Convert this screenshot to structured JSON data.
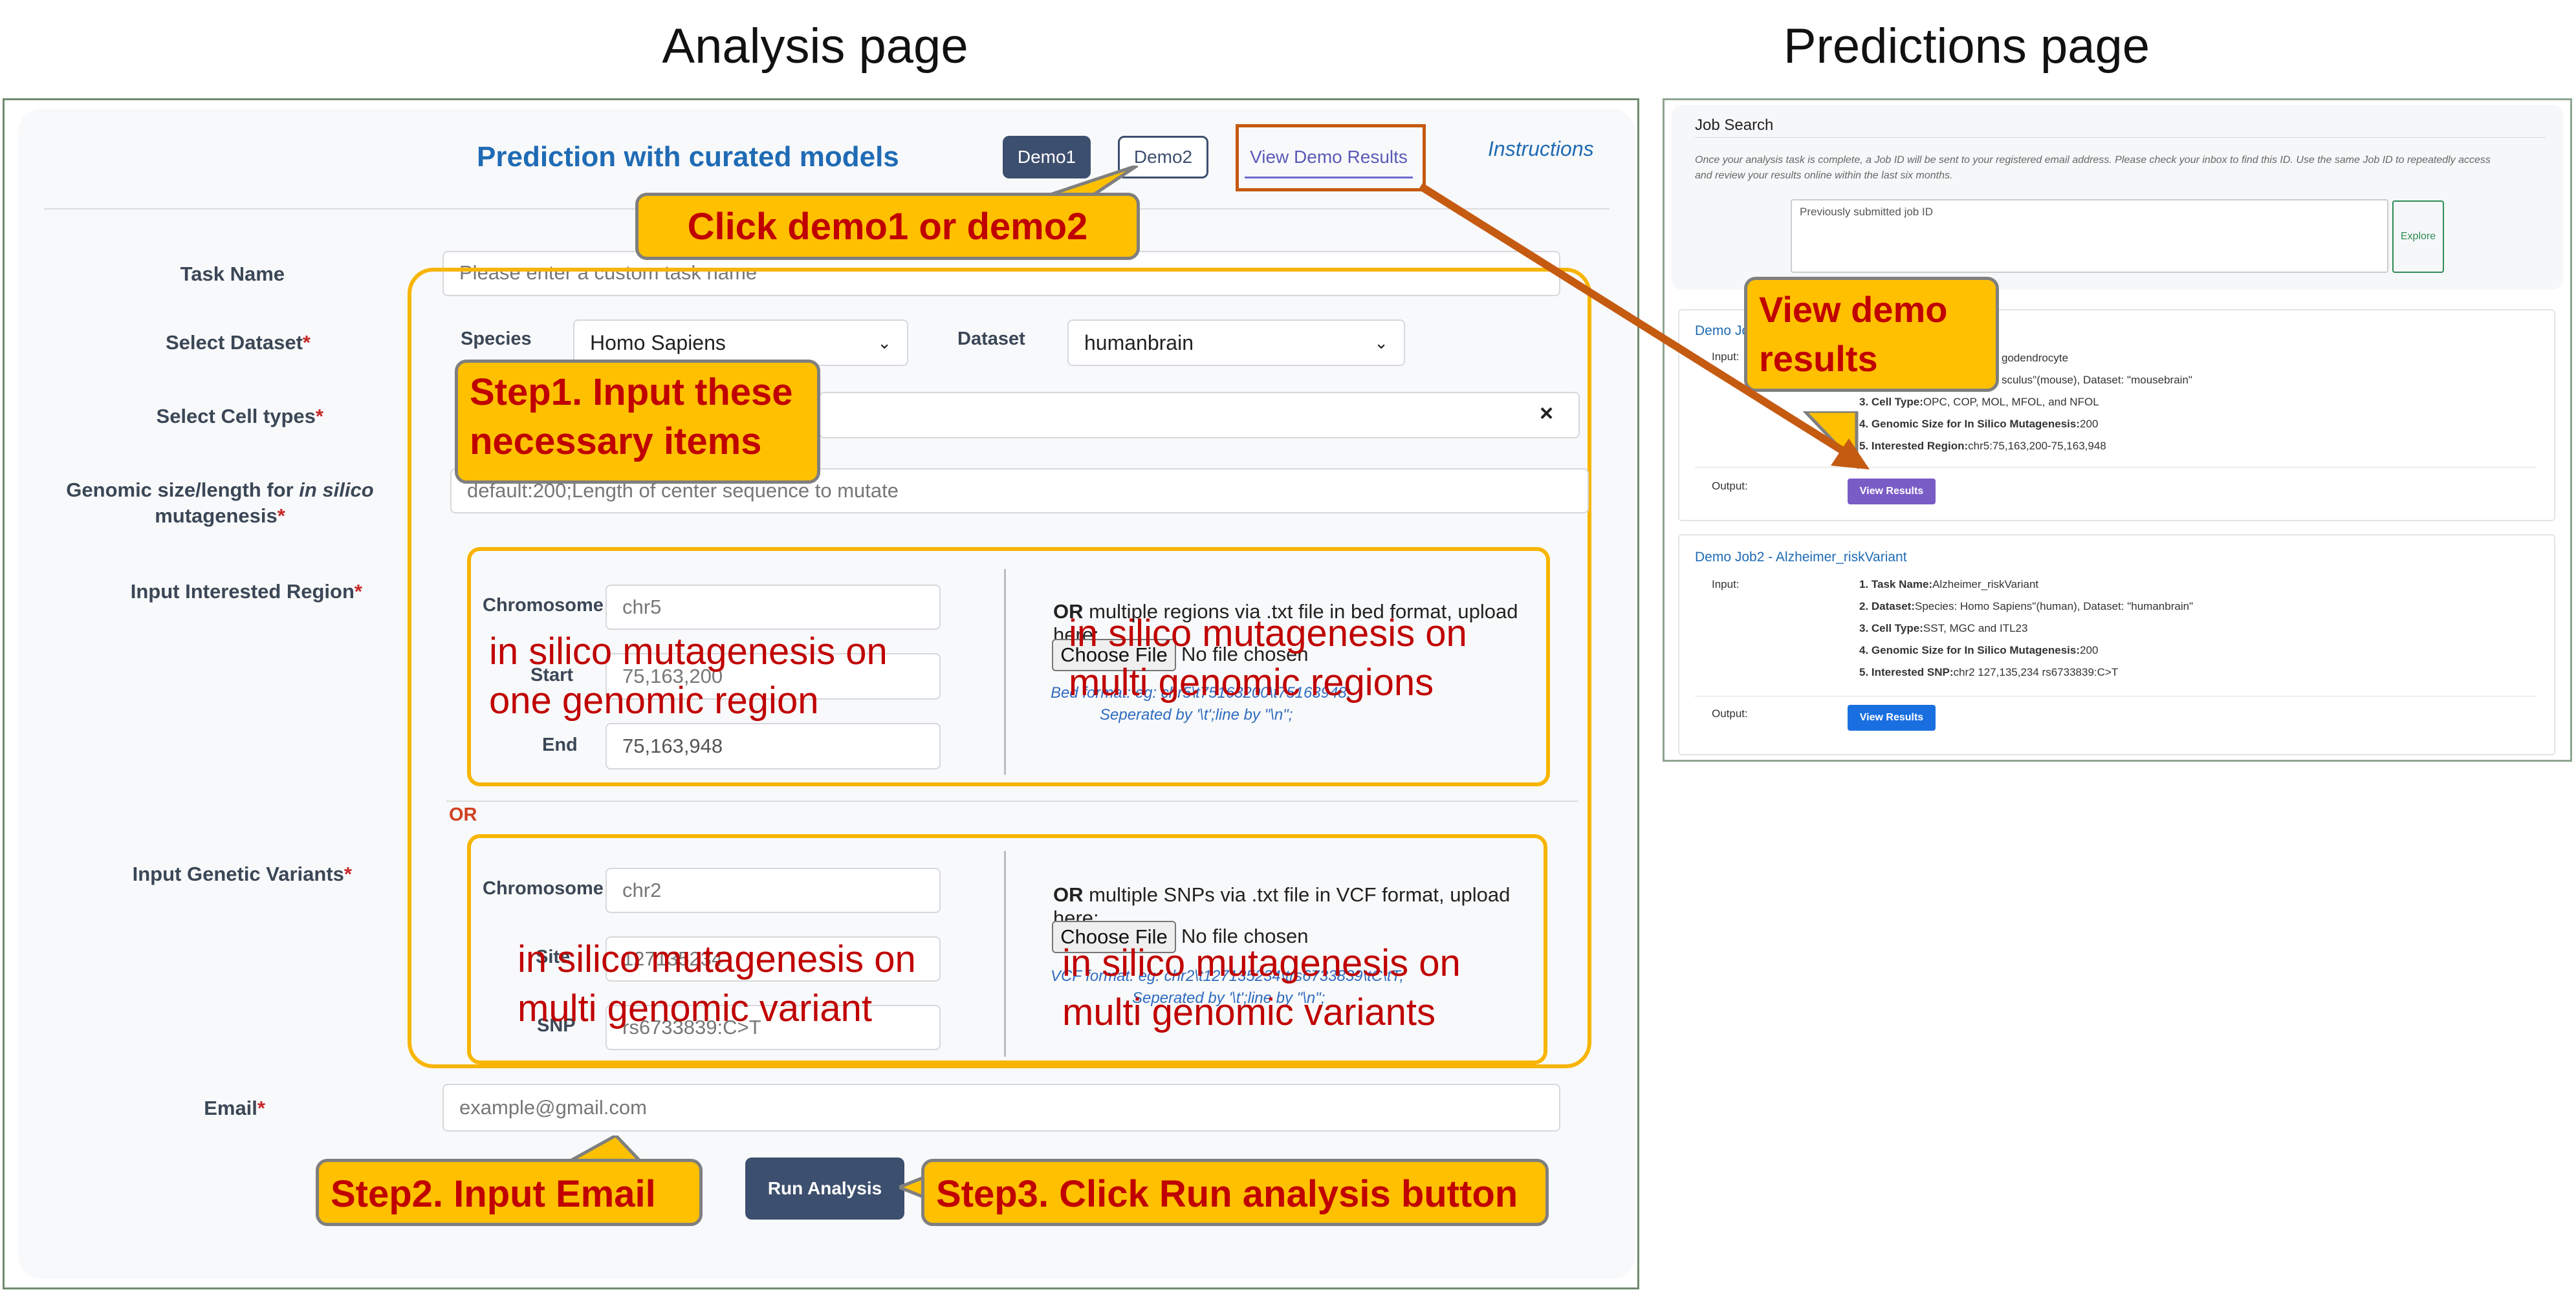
{
  "headings": {
    "analysis": "Analysis page",
    "predictions": "Predictions page"
  },
  "analysis": {
    "title": "Prediction with curated models",
    "demo1": "Demo1",
    "demo2": "Demo2",
    "view_demo": "View Demo Results",
    "instructions": "Instructions",
    "task_name": {
      "label": "Task Name",
      "placeholder": "Please enter a custom task name"
    },
    "dataset": {
      "label": "Select Dataset",
      "species_label": "Species",
      "species_value": "Homo Sapiens",
      "dataset_label": "Dataset",
      "dataset_value": "humanbrain"
    },
    "cell_types": {
      "label": "Select Cell types",
      "clear": "×"
    },
    "genomic_size": {
      "label_pre": "Genomic size/length for ",
      "label_em": "in silico",
      "label_post": " mutagenesis",
      "placeholder": "default:200;Length of center sequence to mutate"
    },
    "region": {
      "label": "Input Interested Region",
      "chromosome_label": "Chromosome",
      "chromosome_value": "chr5",
      "start_label": "Start",
      "start_value": "75,163,200",
      "end_label": "End",
      "end_value": "75,163,948",
      "or_label": "OR",
      "upload_text": " multiple regions via .txt file in bed format, upload here:",
      "choose_file": "Choose File",
      "no_file": "No file chosen",
      "hint1": "Bed format: eg: chr5\\t75163200\\t75163948;",
      "hint2": "Seperated by '\\t';line by \"\\n\";"
    },
    "or_between": "OR",
    "variants": {
      "label": "Input Genetic Variants",
      "chromosome_label": "Chromosome",
      "chromosome_value": "chr2",
      "site_label": "Site",
      "site_value": "127135234",
      "snp_label": "SNP",
      "snp_value": "rs6733839:C>T",
      "or_label": "OR",
      "upload_text": " multiple SNPs via .txt file in VCF format, upload here:",
      "choose_file": "Choose File",
      "no_file": "No file chosen",
      "hint1": "VCF format: eg: chr2\\t127135234\\trs6733839\\tC\\tT;",
      "hint2": "Seperated by '\\t';line by \"\\n\";"
    },
    "email": {
      "label": "Email",
      "placeholder": "example@gmail.com"
    },
    "run": "Run Analysis",
    "req_mark": "*"
  },
  "annotations": {
    "click_demo": "Click demo1 or demo2",
    "step1_line1": "Step1. Input these",
    "step1_line2": "necessary items",
    "region_single_1": "in silico mutagenesis on",
    "region_single_2": "one genomic region",
    "region_multi_1": "in silico mutagenesis on",
    "region_multi_2": "multi genomic regions",
    "variant_single_1": "in silico mutagenesis on",
    "variant_single_2": "multi genomic variant",
    "variant_multi_1": "in silico mutagenesis on",
    "variant_multi_2": "multi genomic variants",
    "step2": "Step2. Input Email",
    "step3": "Step3. Click Run analysis button",
    "view_demo_1": "View demo",
    "view_demo_2": "results"
  },
  "predictions": {
    "job_search_title": "Job Search",
    "job_search_desc_1": "Once your analysis task is complete, a Job ID will be sent to your registered email address. Please check your inbox to find this ID. Use the same Job ID to repeatedly access",
    "job_search_desc_2": "and review your results online within the last six months.",
    "job_id_placeholder": "Previously submitted job ID",
    "explore": "Explore",
    "job1": {
      "title": "Demo Job1",
      "input_label": "Input:",
      "items": [
        {
          "k": "",
          "v": "godendrocyte"
        },
        {
          "k": "",
          "v": "sculus\"(mouse), Dataset: \"mousebrain\""
        },
        {
          "k": "3. Cell Type:",
          "v": "OPC, COP, MOL, MFOL, and NFOL"
        },
        {
          "k": "4. Genomic Size for In Silico Mutagenesis:",
          "v": "200"
        },
        {
          "k": "5. Interested Region:",
          "v": "chr5:75,163,200-75,163,948"
        }
      ],
      "output_label": "Output:",
      "button": "View Results"
    },
    "job2": {
      "title": "Demo Job2 - Alzheimer_riskVariant",
      "input_label": "Input:",
      "items": [
        {
          "k": "1. Task Name:",
          "v": "Alzheimer_riskVariant"
        },
        {
          "k": "2. Dataset:",
          "v": "Species: Homo Sapiens\"(human), Dataset: \"humanbrain\""
        },
        {
          "k": "3. Cell Type:",
          "v": "SST, MGC and ITL23"
        },
        {
          "k": "4. Genomic Size for In Silico Mutagenesis:",
          "v": "200"
        },
        {
          "k": "5. Interested SNP:",
          "v": "chr2 127,135,234 rs6733839:C>T"
        }
      ],
      "output_label": "Output:",
      "button": "View Results"
    }
  },
  "colors": {
    "callout": "#ffc000",
    "callout_text": "#c00000",
    "arrow": "#c55a11",
    "accent": "#1f6bb5",
    "dark_button": "#3d4f6e"
  }
}
